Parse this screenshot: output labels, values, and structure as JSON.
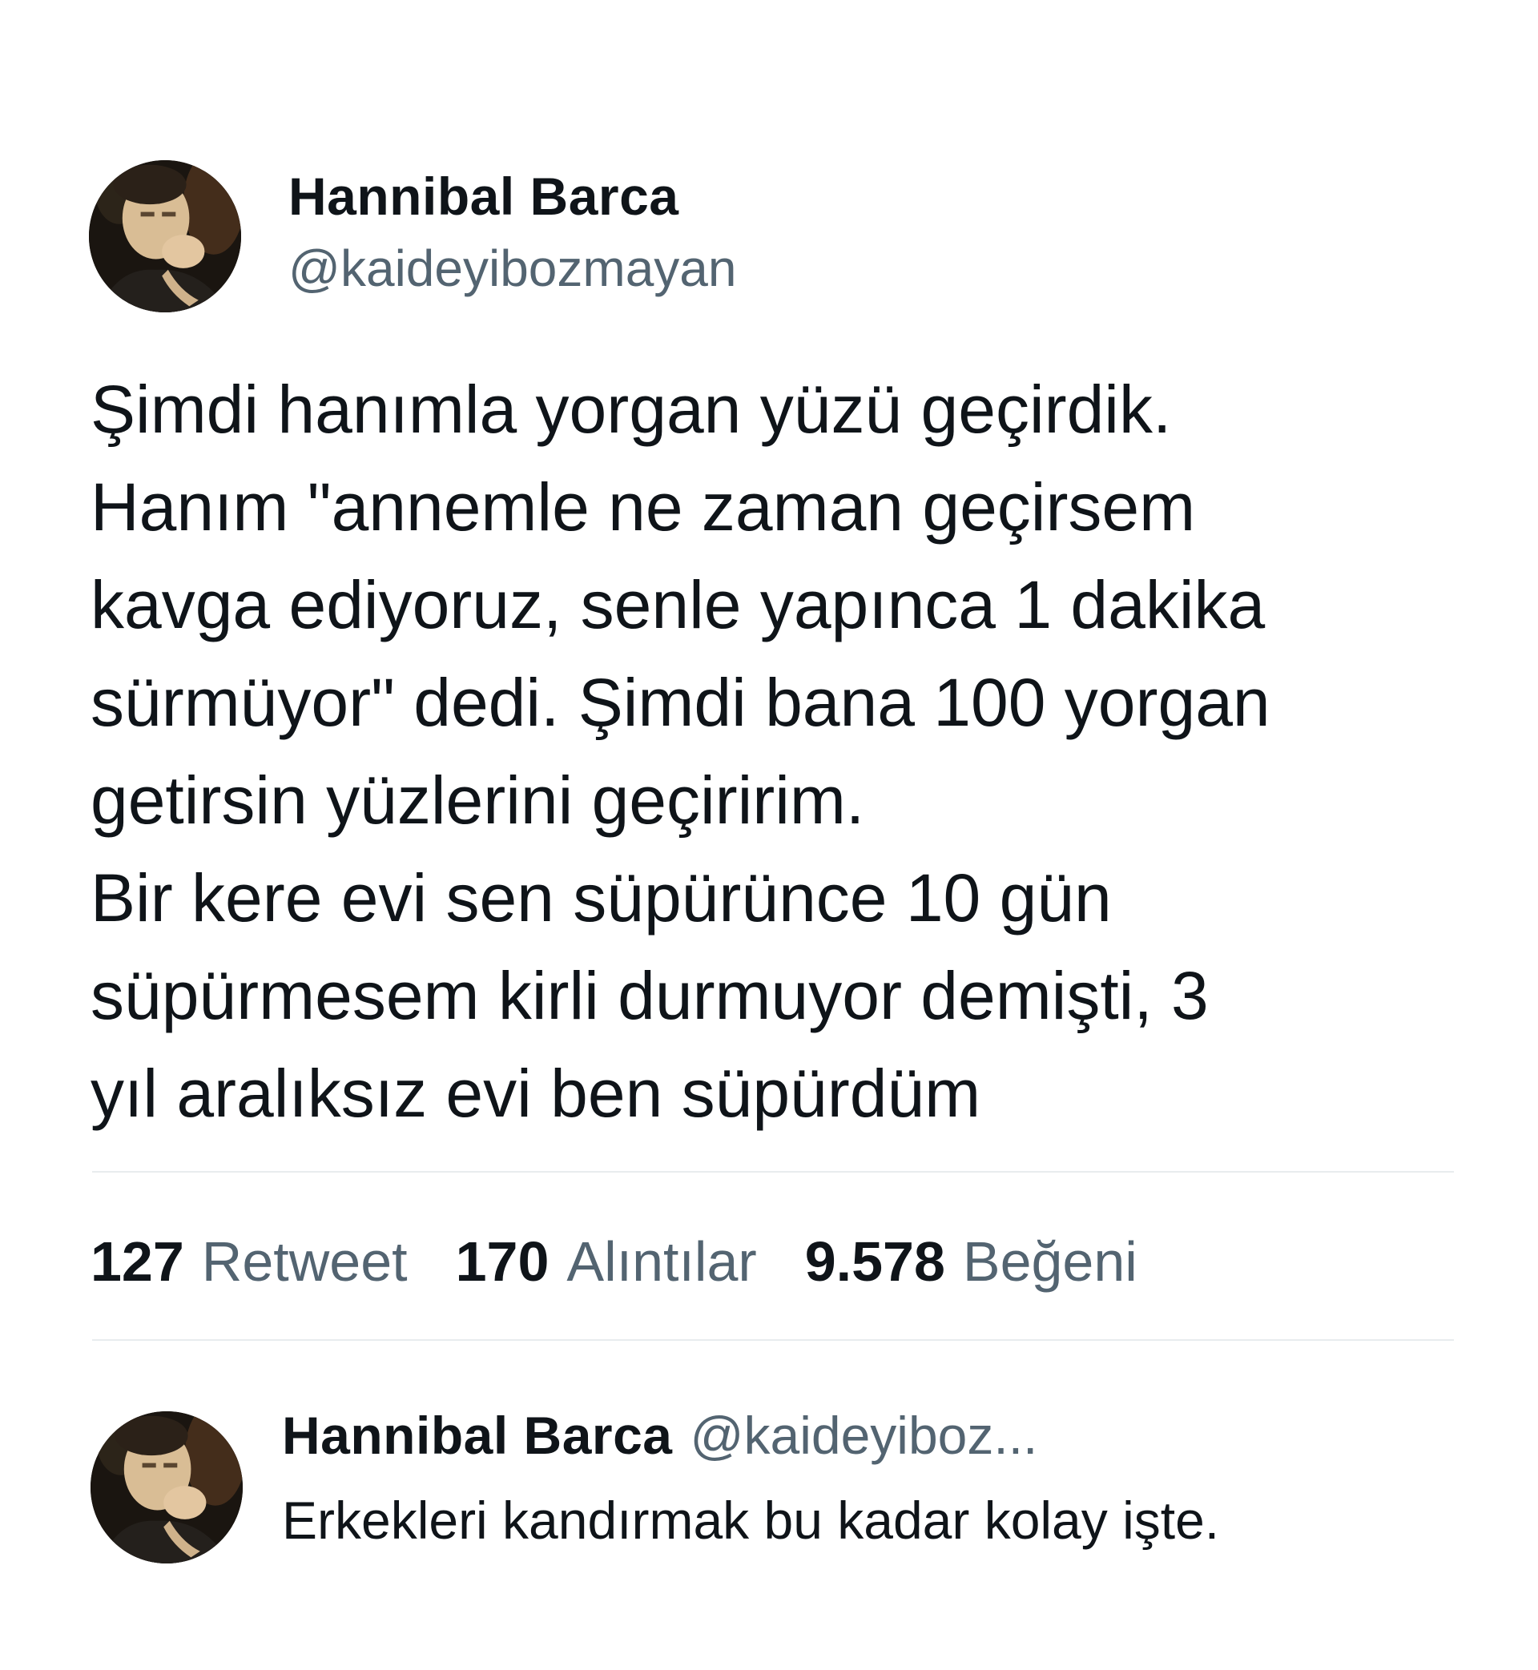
{
  "tweet": {
    "author": {
      "display_name": "Hannibal Barca",
      "handle": "@kaideyibozmayan",
      "avatar_icon": "profile-photo"
    },
    "text_lines": [
      "Şimdi hanımla yorgan yüzü geçirdik.",
      "Hanım \"annemle ne zaman geçirsem",
      "kavga ediyoruz, senle yapınca 1 dakika",
      "sürmüyor\" dedi. Şimdi bana 100 yorgan",
      "getirsin yüzlerini geçiririm.",
      "Bir kere evi sen süpürünce 10 gün",
      "süpürmesem kirli durmuyor demişti, 3",
      "yıl aralıksız evi ben süpürdüm"
    ],
    "stats": {
      "retweets": {
        "count": "127",
        "label": "Retweet"
      },
      "quotes": {
        "count": "170",
        "label": "Alıntılar"
      },
      "likes": {
        "count": "9.578",
        "label": "Beğeni"
      }
    }
  },
  "reply": {
    "author": {
      "display_name": "Hannibal Barca",
      "handle": "@kaideyiboz...",
      "avatar_icon": "profile-photo"
    },
    "text": "Erkekleri kandırmak bu kadar kolay işte."
  },
  "colors": {
    "text_primary": "#0f1419",
    "text_secondary": "#536471",
    "divider": "#e8ecee",
    "background": "#ffffff"
  }
}
